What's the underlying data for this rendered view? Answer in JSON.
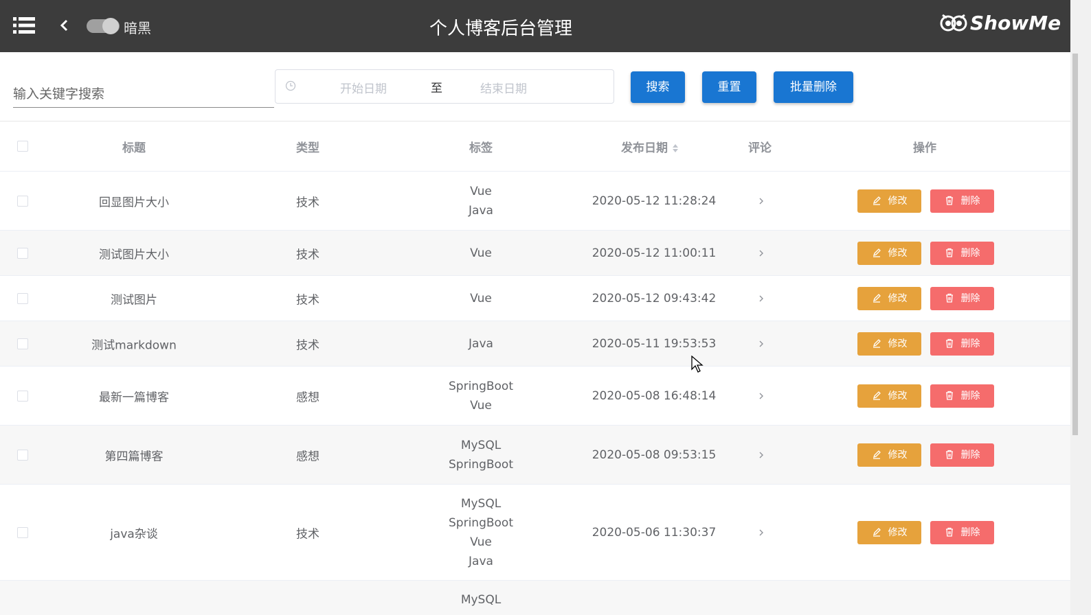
{
  "header": {
    "title": "个人博客后台管理",
    "dark_mode_label": "暗黑",
    "logo_text": "ShowMe"
  },
  "filters": {
    "search_placeholder": "输入关键字搜索",
    "date_start_placeholder": "开始日期",
    "date_separator": "至",
    "date_end_placeholder": "结束日期",
    "search_button": "搜索",
    "reset_button": "重置",
    "batch_delete_button": "批量删除"
  },
  "table": {
    "columns": {
      "title": "标题",
      "type": "类型",
      "tags": "标签",
      "date": "发布日期",
      "comments": "评论",
      "actions": "操作"
    },
    "edit_label": "修改",
    "delete_label": "删除",
    "rows": [
      {
        "title": "回显图片大小",
        "type": "技术",
        "tags": [
          "Vue",
          "Java"
        ],
        "date": "2020-05-12 11:28:24"
      },
      {
        "title": "测试图片大小",
        "type": "技术",
        "tags": [
          "Vue"
        ],
        "date": "2020-05-12 11:00:11"
      },
      {
        "title": "测试图片",
        "type": "技术",
        "tags": [
          "Vue"
        ],
        "date": "2020-05-12 09:43:42"
      },
      {
        "title": "测试markdown",
        "type": "技术",
        "tags": [
          "Java"
        ],
        "date": "2020-05-11 19:53:53"
      },
      {
        "title": "最新一篇博客",
        "type": "感想",
        "tags": [
          "SpringBoot",
          "Vue"
        ],
        "date": "2020-05-08 16:48:14"
      },
      {
        "title": "第四篇博客",
        "type": "感想",
        "tags": [
          "MySQL",
          "SpringBoot"
        ],
        "date": "2020-05-08 09:53:15"
      },
      {
        "title": "java杂谈",
        "type": "技术",
        "tags": [
          "MySQL",
          "SpringBoot",
          "Vue",
          "Java"
        ],
        "date": "2020-05-06 11:30:37"
      },
      {
        "title": "",
        "type": "",
        "tags": [
          "MySQL"
        ],
        "date": ""
      }
    ]
  },
  "colors": {
    "header_bg": "#3c3c3c",
    "primary": "#1976d2",
    "warning": "#e6a23c",
    "danger": "#f56c6c"
  }
}
